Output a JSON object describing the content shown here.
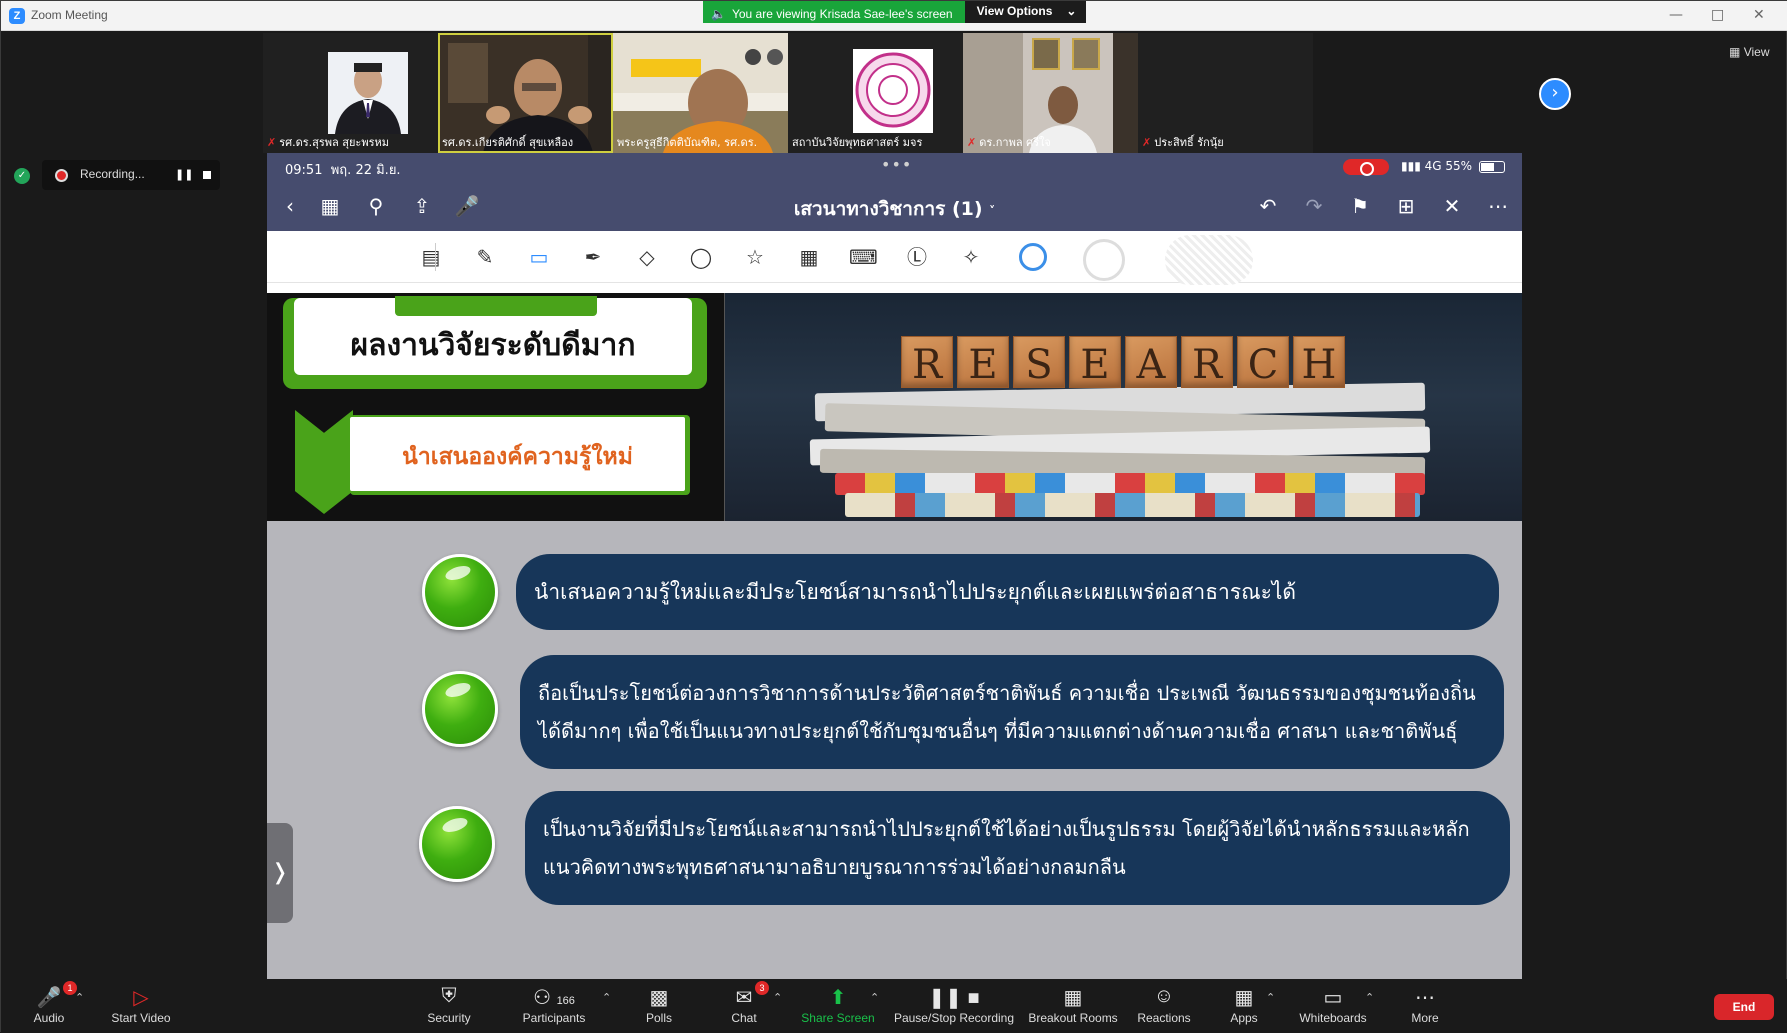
{
  "window": {
    "app_title": "Zoom Meeting",
    "viewing_banner": "You are viewing Krisada Sae-lee's screen",
    "view_options_label": "View Options",
    "view_button_label": "View"
  },
  "participants": [
    {
      "name": "รศ.ดร.สุรพล สุยะพรหม",
      "muted": true
    },
    {
      "name": "รศ.ดร.เกียรติศักดิ์ สุขเหลือง",
      "muted": false
    },
    {
      "name": "พระครูสุธีกิตติบัณฑิต, รศ.ดร.",
      "muted": false
    },
    {
      "name": "สถาบันวิจัยพุทธศาสตร์ มจร",
      "muted": false
    },
    {
      "name": "ดร.กาพล ศรีใจ",
      "muted": true
    },
    {
      "name": "ประสิทธิ์ รักนุ้ย",
      "muted": true
    }
  ],
  "recording": {
    "label": "Recording..."
  },
  "ipad": {
    "time": "09:51",
    "date": "พฤ. 22 มิ.ย.",
    "network": "4G 55%",
    "doc_title": "เสวนาทางวิชาการ (1)"
  },
  "slide": {
    "title": "ผลงานวิจัยระดับดีมาก",
    "subtitle": "นำเสนอองค์ความรู้ใหม่",
    "research_letters": [
      "R",
      "E",
      "S",
      "E",
      "A",
      "R",
      "C",
      "H"
    ],
    "bullets": [
      {
        "lines": [
          "นำเสนอความรู้ใหม่และมีประโยชน์สามารถนำไปประยุกต์และเผยแพร่ต่อสาธารณะได้"
        ]
      },
      {
        "lines": [
          "ถือเป็นประโยชน์ต่อวงการวิชาการด้านประวัติศาสตร์ชาติพันธ์ ความเชื่อ ประเพณี วัฒนธรรมของชุมชนท้องถิ่น",
          "ได้ดีมากๆ เพื่อใช้เป็นแนวทางประยุกต์ใช้กับชุมชนอื่นๆ ที่มีความแตกต่างด้านความเชื่อ ศาสนา และชาติพันธุ์"
        ]
      },
      {
        "lines": [
          "เป็นงานวิจัยที่มีประโยชน์และสามารถนำไปประยุกต์ใช้ได้อย่างเป็นรูปธรรม โดยผู้วิจัยได้นำหลักธรรมและหลัก",
          "แนวคิดทางพระพุทธศาสนามาอธิบายบูรณาการร่วมได้อย่างกลมกลืน"
        ]
      }
    ]
  },
  "toolbar": {
    "audio": "Audio",
    "start_video": "Start Video",
    "security": "Security",
    "participants": "Participants",
    "participants_count": "166",
    "polls": "Polls",
    "chat": "Chat",
    "chat_badge": "3",
    "share_screen": "Share Screen",
    "pause_stop_recording": "Pause/Stop Recording",
    "breakout_rooms": "Breakout Rooms",
    "reactions": "Reactions",
    "apps": "Apps",
    "whiteboards": "Whiteboards",
    "more": "More",
    "end": "End",
    "audio_badge": "1"
  }
}
